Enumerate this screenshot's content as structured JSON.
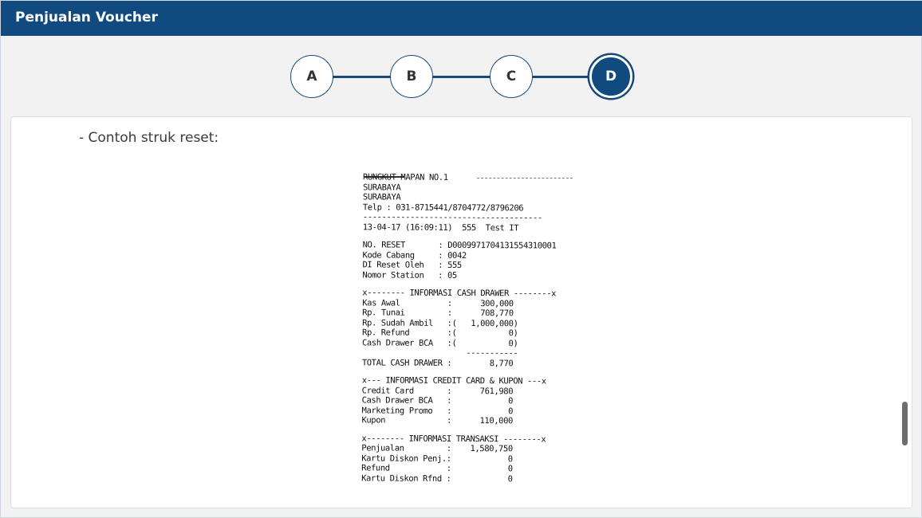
{
  "header": {
    "title": "Penjualan Voucher"
  },
  "stepper": {
    "steps": [
      {
        "label": "A"
      },
      {
        "label": "B"
      },
      {
        "label": "C"
      },
      {
        "label": "D"
      }
    ]
  },
  "content": {
    "intro": "- Contoh struk reset:",
    "receipt": {
      "lines": [
        "RUNGKUT MAPAN NO.1",
        "SURABAYA",
        "SURABAYA",
        "Telp : 031-8715441/8704772/8796206",
        "--------------------------------------",
        "13-04-17 (16:09:11)  555  Test IT",
        "",
        "NO. RESET       : D0009971704131554310001",
        "Kode Cabang     : 0042",
        "DI Reset Oleh   : 555",
        "Nomor Station   : 05",
        "",
        "x-------- INFORMASI CASH DRAWER --------x",
        "Kas Awal          :      300,000",
        "Rp. Tunai         :      708,770",
        "Rp. Sudah Ambil   :(   1,000,000)",
        "Rp. Refund        :(           0)",
        "Cash Drawer BCA   :(           0)",
        "                      -----------",
        "TOTAL CASH DRAWER :        8,770",
        "",
        "x--- INFORMASI CREDIT CARD & KUPON ---x",
        "Credit Card       :      761,980",
        "Cash Drawer BCA   :            0",
        "Marketing Promo   :            0",
        "Kupon             :      110,000",
        "",
        "x-------- INFORMASI TRANSAKSI --------x",
        "Penjualan         :    1,580,750",
        "Kartu Diskon Penj.:            0",
        "Refund            :            0",
        "Kartu Diskon Rfnd :            0"
      ]
    }
  }
}
